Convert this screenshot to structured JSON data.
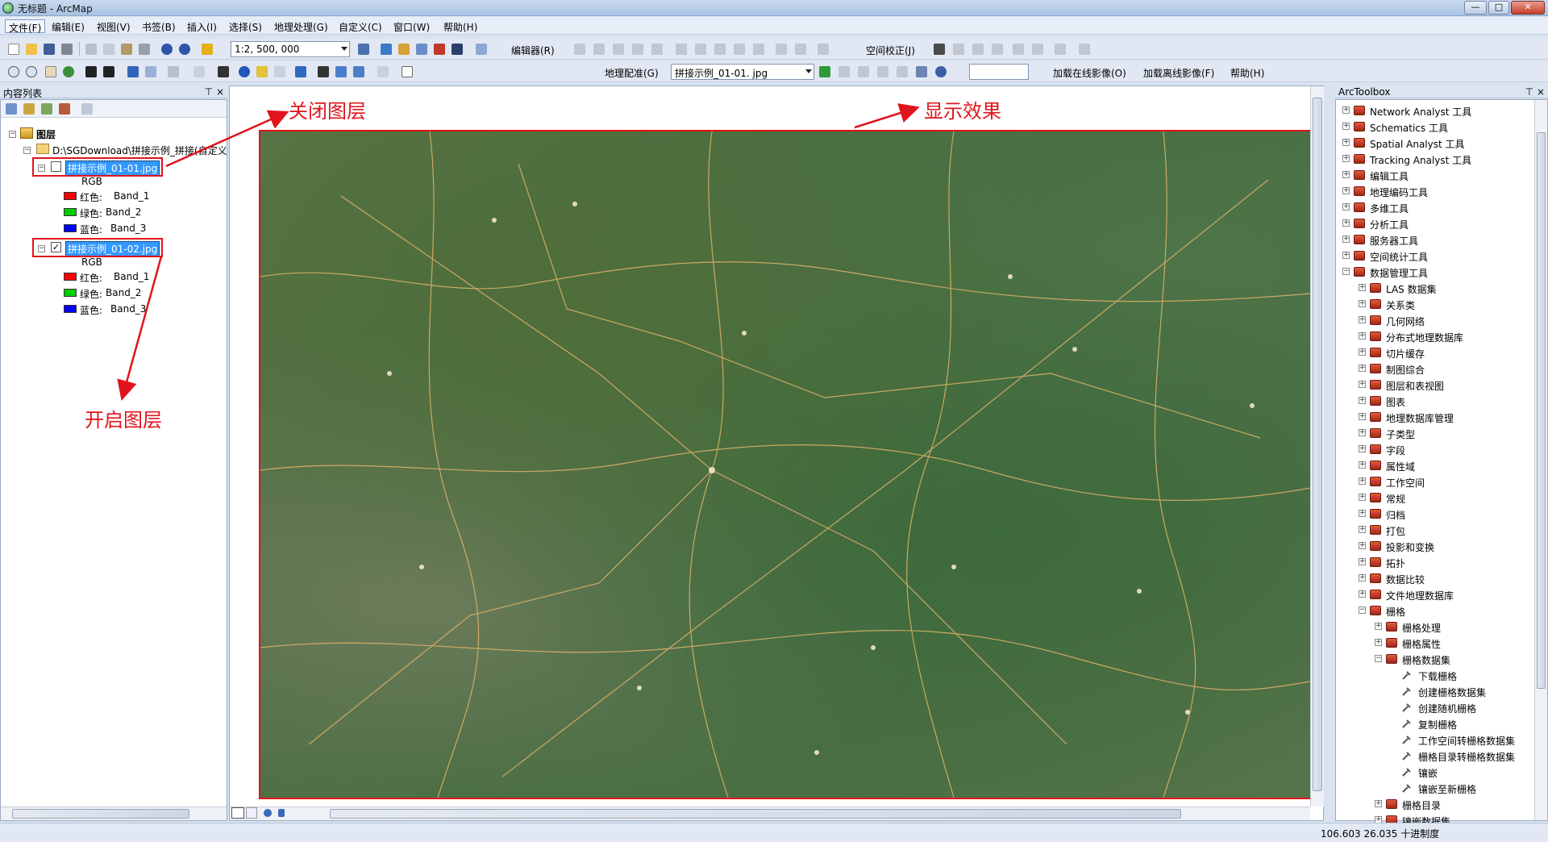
{
  "window": {
    "title": "无标题 - ArcMap",
    "min": "—",
    "max": "□",
    "close": "✕"
  },
  "menu": [
    "文件(F)",
    "编辑(E)",
    "视图(V)",
    "书签(B)",
    "插入(I)",
    "选择(S)",
    "地理处理(G)",
    "自定义(C)",
    "窗口(W)",
    "帮助(H)"
  ],
  "toolbar1": {
    "scale": "1:2, 500, 000",
    "editor_label": "编辑器(R)",
    "spatial_adjust_label": "空间校正(J)"
  },
  "toolbar2": {
    "georef_label": "地理配准(G)",
    "georef_layer": "拼接示例_01-01. jpg",
    "online_imagery_label": "加载在线影像(O)",
    "offline_imagery_label": "加载离线影像(F)",
    "help_label": "帮助(H)"
  },
  "toc": {
    "header": "内容列表",
    "pin": "⊤ ×",
    "root": "图层",
    "group": "D:\\SGDownload\\拼接示例_拼接(自定义",
    "layers": [
      {
        "name": "拼接示例_01-01.jpg",
        "checked": "",
        "rgb": "RGB",
        "bands": [
          {
            "label": "红色:",
            "band": "Band_1",
            "color": "#ff0000"
          },
          {
            "label": "绿色:",
            "band": "Band_2",
            "color": "#00cc00"
          },
          {
            "label": "蓝色:",
            "band": "Band_3",
            "color": "#0000ff"
          }
        ]
      },
      {
        "name": "拼接示例_01-02.jpg",
        "checked": "✓",
        "rgb": "RGB",
        "bands": [
          {
            "label": "红色:",
            "band": "Band_1",
            "color": "#ff0000"
          },
          {
            "label": "绿色:",
            "band": "Band_2",
            "color": "#00cc00"
          },
          {
            "label": "蓝色:",
            "band": "Band_3",
            "color": "#0000ff"
          }
        ]
      }
    ]
  },
  "annotations": {
    "close_layer": "关闭图层",
    "open_layer": "开启图层",
    "display_effect": "显示效果"
  },
  "toolbox": {
    "header": "ArcToolbox",
    "pin": "⊤ ×",
    "items": [
      {
        "label": "Network Analyst 工具",
        "level": 0,
        "exp": "+",
        "kind": "box"
      },
      {
        "label": "Schematics 工具",
        "level": 0,
        "exp": "+",
        "kind": "box"
      },
      {
        "label": "Spatial Analyst 工具",
        "level": 0,
        "exp": "+",
        "kind": "box"
      },
      {
        "label": "Tracking Analyst 工具",
        "level": 0,
        "exp": "+",
        "kind": "box"
      },
      {
        "label": "编辑工具",
        "level": 0,
        "exp": "+",
        "kind": "box"
      },
      {
        "label": "地理编码工具",
        "level": 0,
        "exp": "+",
        "kind": "box"
      },
      {
        "label": "多维工具",
        "level": 0,
        "exp": "+",
        "kind": "box"
      },
      {
        "label": "分析工具",
        "level": 0,
        "exp": "+",
        "kind": "box"
      },
      {
        "label": "服务器工具",
        "level": 0,
        "exp": "+",
        "kind": "box"
      },
      {
        "label": "空间统计工具",
        "level": 0,
        "exp": "+",
        "kind": "box"
      },
      {
        "label": "数据管理工具",
        "level": 0,
        "exp": "−",
        "kind": "box"
      },
      {
        "label": "LAS 数据集",
        "level": 1,
        "exp": "+",
        "kind": "box"
      },
      {
        "label": "关系类",
        "level": 1,
        "exp": "+",
        "kind": "box"
      },
      {
        "label": "几何网络",
        "level": 1,
        "exp": "+",
        "kind": "box"
      },
      {
        "label": "分布式地理数据库",
        "level": 1,
        "exp": "+",
        "kind": "box"
      },
      {
        "label": "切片缓存",
        "level": 1,
        "exp": "+",
        "kind": "box"
      },
      {
        "label": "制图综合",
        "level": 1,
        "exp": "+",
        "kind": "box"
      },
      {
        "label": "图层和表视图",
        "level": 1,
        "exp": "+",
        "kind": "box"
      },
      {
        "label": "图表",
        "level": 1,
        "exp": "+",
        "kind": "box"
      },
      {
        "label": "地理数据库管理",
        "level": 1,
        "exp": "+",
        "kind": "box"
      },
      {
        "label": "子类型",
        "level": 1,
        "exp": "+",
        "kind": "box"
      },
      {
        "label": "字段",
        "level": 1,
        "exp": "+",
        "kind": "box"
      },
      {
        "label": "属性域",
        "level": 1,
        "exp": "+",
        "kind": "box"
      },
      {
        "label": "工作空间",
        "level": 1,
        "exp": "+",
        "kind": "box"
      },
      {
        "label": "常规",
        "level": 1,
        "exp": "+",
        "kind": "box"
      },
      {
        "label": "归档",
        "level": 1,
        "exp": "+",
        "kind": "box"
      },
      {
        "label": "打包",
        "level": 1,
        "exp": "+",
        "kind": "box"
      },
      {
        "label": "投影和变换",
        "level": 1,
        "exp": "+",
        "kind": "box"
      },
      {
        "label": "拓扑",
        "level": 1,
        "exp": "+",
        "kind": "box"
      },
      {
        "label": "数据比较",
        "level": 1,
        "exp": "+",
        "kind": "box"
      },
      {
        "label": "文件地理数据库",
        "level": 1,
        "exp": "+",
        "kind": "box"
      },
      {
        "label": "栅格",
        "level": 1,
        "exp": "−",
        "kind": "box"
      },
      {
        "label": "栅格处理",
        "level": 2,
        "exp": "+",
        "kind": "box"
      },
      {
        "label": "栅格属性",
        "level": 2,
        "exp": "+",
        "kind": "box"
      },
      {
        "label": "栅格数据集",
        "level": 2,
        "exp": "−",
        "kind": "box"
      },
      {
        "label": "下载栅格",
        "level": 3,
        "exp": "",
        "kind": "tool"
      },
      {
        "label": "创建栅格数据集",
        "level": 3,
        "exp": "",
        "kind": "tool"
      },
      {
        "label": "创建随机栅格",
        "level": 3,
        "exp": "",
        "kind": "tool"
      },
      {
        "label": "复制栅格",
        "level": 3,
        "exp": "",
        "kind": "tool"
      },
      {
        "label": "工作空间转栅格数据集",
        "level": 3,
        "exp": "",
        "kind": "tool"
      },
      {
        "label": "栅格目录转栅格数据集",
        "level": 3,
        "exp": "",
        "kind": "tool"
      },
      {
        "label": "镶嵌",
        "level": 3,
        "exp": "",
        "kind": "tool"
      },
      {
        "label": "镶嵌至新栅格",
        "level": 3,
        "exp": "",
        "kind": "tool"
      },
      {
        "label": "栅格目录",
        "level": 2,
        "exp": "+",
        "kind": "box"
      },
      {
        "label": "镶嵌数据集",
        "level": 2,
        "exp": "+",
        "kind": "box"
      }
    ]
  },
  "status": {
    "coords": "106.603  26.035 十进制度"
  },
  "colors": {
    "annotation_red": "#e0141c",
    "selection_blue": "#3399ff"
  }
}
